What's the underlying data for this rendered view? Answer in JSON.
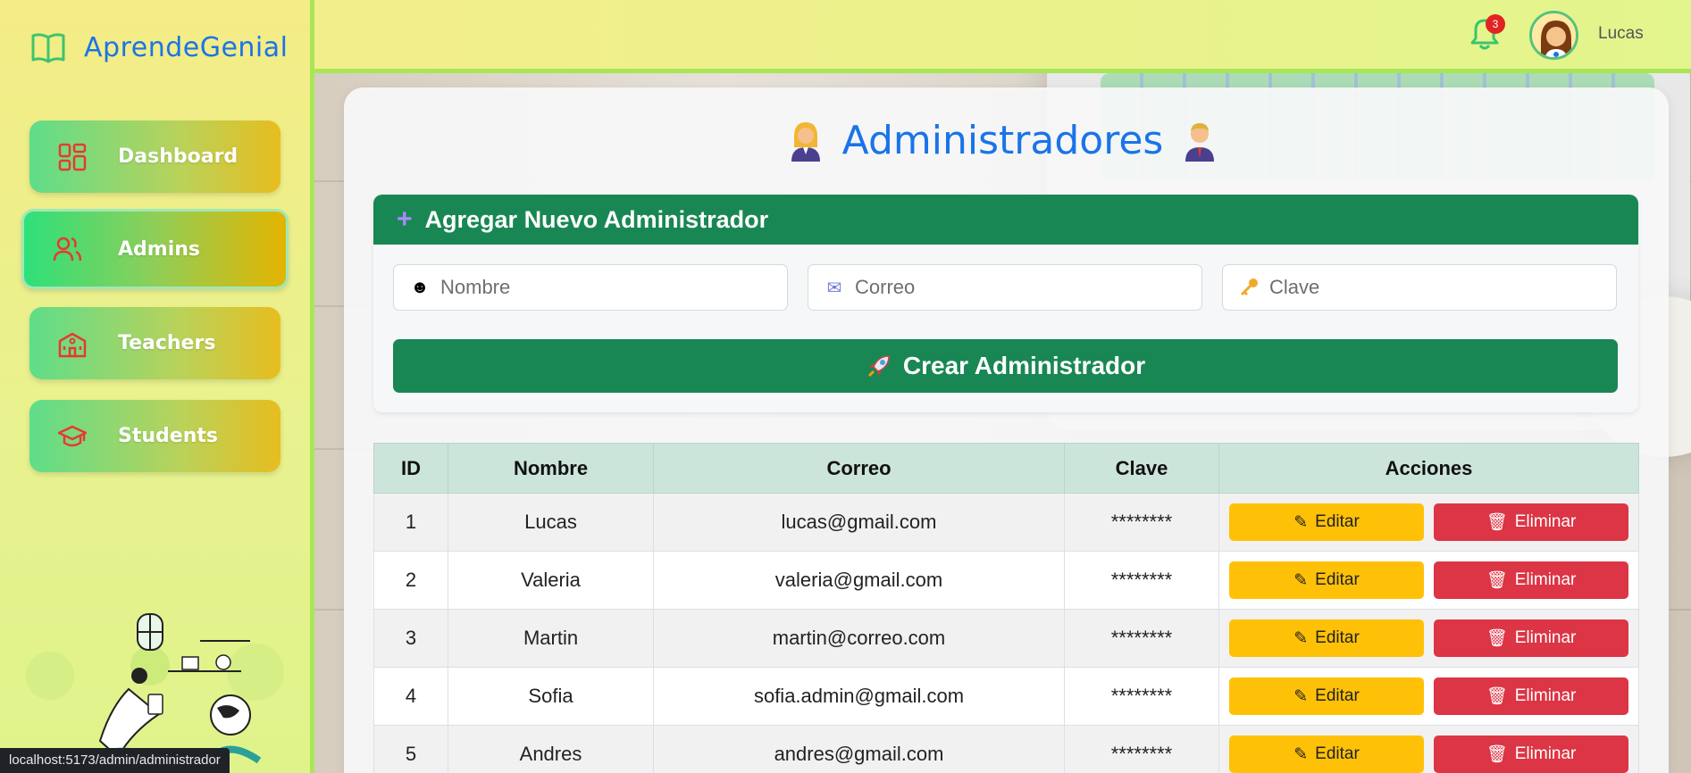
{
  "brand": {
    "name": "AprendeGenial"
  },
  "sidebar": {
    "items": [
      {
        "label": "Dashboard",
        "icon": "dashboard-icon",
        "active": false
      },
      {
        "label": "Admins",
        "icon": "users-icon",
        "active": true
      },
      {
        "label": "Teachers",
        "icon": "school-icon",
        "active": false
      },
      {
        "label": "Students",
        "icon": "graduation-cap-icon",
        "active": false
      }
    ]
  },
  "status_bar": {
    "url": "localhost:5173/admin/administrador"
  },
  "topbar": {
    "notification_count": "3",
    "username": "Lucas"
  },
  "page": {
    "title": "Administradores"
  },
  "form": {
    "title": "Agregar Nuevo Administrador",
    "fields": {
      "nombre": {
        "placeholder": "Nombre",
        "value": ""
      },
      "correo": {
        "placeholder": "Correo",
        "value": ""
      },
      "clave": {
        "placeholder": "Clave",
        "value": ""
      }
    },
    "submit_label": "Crear Administrador"
  },
  "table": {
    "headers": {
      "id": "ID",
      "nombre": "Nombre",
      "correo": "Correo",
      "clave": "Clave",
      "acciones": "Acciones"
    },
    "edit_label": "Editar",
    "delete_label": "Eliminar",
    "rows": [
      {
        "id": "1",
        "nombre": "Lucas",
        "correo": "lucas@gmail.com",
        "clave": "********"
      },
      {
        "id": "2",
        "nombre": "Valeria",
        "correo": "valeria@gmail.com",
        "clave": "********"
      },
      {
        "id": "3",
        "nombre": "Martin",
        "correo": "martin@correo.com",
        "clave": "********"
      },
      {
        "id": "4",
        "nombre": "Sofia",
        "correo": "sofia.admin@gmail.com",
        "clave": "********"
      },
      {
        "id": "5",
        "nombre": "Andres",
        "correo": "andres@gmail.com",
        "clave": "********"
      }
    ]
  },
  "colors": {
    "brand_blue": "#1a74e8",
    "success_green": "#198754",
    "edit_yellow": "#ffc107",
    "delete_red": "#dc3545"
  }
}
